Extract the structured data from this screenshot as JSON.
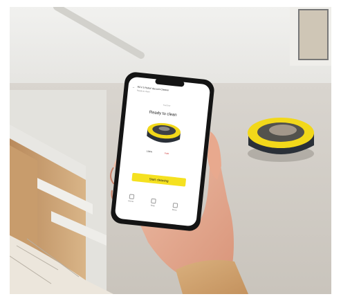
{
  "app": {
    "header_title": "RCV 5 Robot Vacuum Cleaner",
    "header_subtitle": "Ready to clean",
    "top_label": "Karcher",
    "status_text": "Ready to clean",
    "battery_label": "100%",
    "mode_label": "Auto",
    "start_button_label": "Start cleaning",
    "nav": [
      {
        "label": "Home",
        "icon": "home-icon"
      },
      {
        "label": "Map",
        "icon": "map-icon"
      },
      {
        "label": "More",
        "icon": "more-icon"
      }
    ]
  },
  "colors": {
    "accent": "#f5e120",
    "robot_body": "#2a3038",
    "robot_ring": "#f2d81a",
    "phone_frame": "#141414",
    "screen_bg": "#ffffff",
    "floor": "#d3cfc7",
    "wall": "#ececea"
  }
}
